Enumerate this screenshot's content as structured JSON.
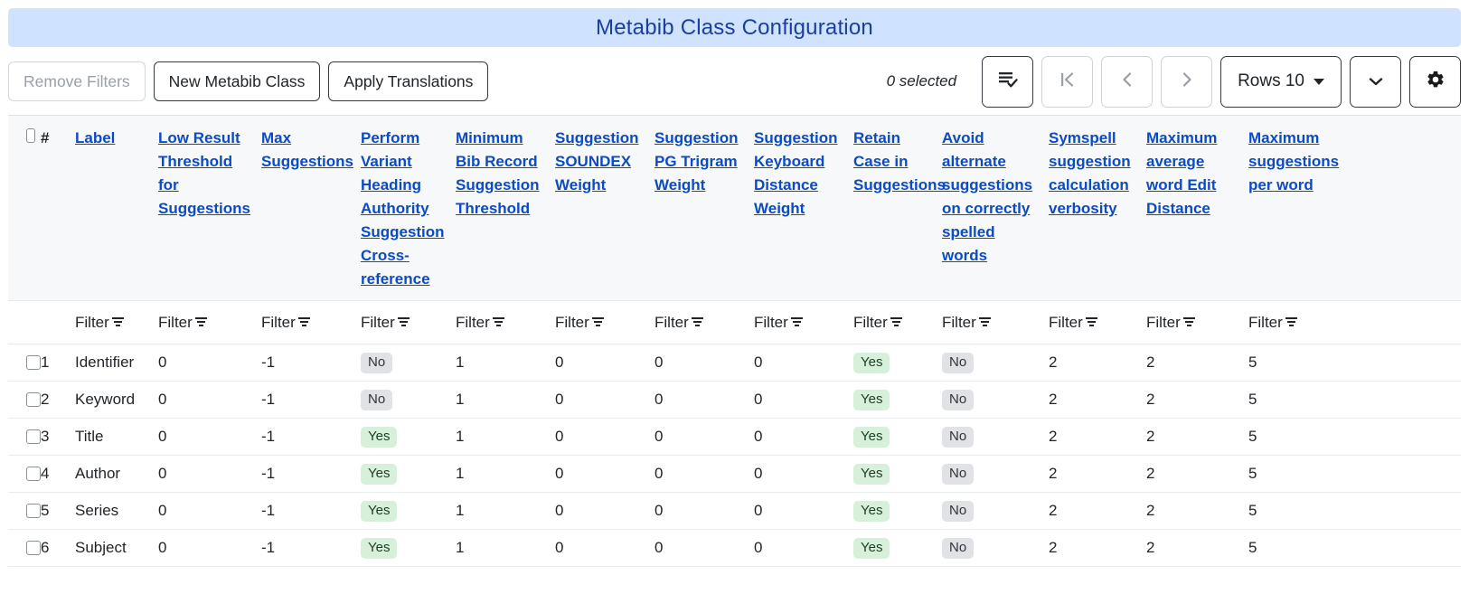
{
  "window": {
    "title": "Metabib Class Configuration",
    "title_bg": "#cfe2ff",
    "title_color": "#1a3fa0"
  },
  "toolbar": {
    "remove_filters_label": "Remove Filters",
    "new_metabib_class_label": "New Metabib Class",
    "apply_translations_label": "Apply Translations",
    "selected_count": "0 selected",
    "select_actions_icon": "list-check-icon",
    "first_page_icon": "first-page-icon",
    "prev_page_icon": "chevron-left-icon",
    "next_page_icon": "chevron-right-icon",
    "rows_label": "Rows 10",
    "rows_caret_icon": "caret-down-icon",
    "expand_icon": "chevron-down-icon",
    "settings_icon": "gear-icon"
  },
  "table": {
    "select_all_checkbox": "select-all-checkbox",
    "filter_label": "Filter",
    "filter_icon": "funnel-icon",
    "columns": [
      {
        "key": "num",
        "label": "#",
        "type": "plain"
      },
      {
        "key": "label",
        "label": "Label",
        "type": "link"
      },
      {
        "key": "c0",
        "label": "Low Result Threshold for Suggestions",
        "type": "link"
      },
      {
        "key": "c1",
        "label": "Max Suggestions",
        "type": "link"
      },
      {
        "key": "c2",
        "label": "Perform Variant Heading Authority Suggestion Cross-reference",
        "type": "link"
      },
      {
        "key": "c3",
        "label": "Minimum Bib Record Suggestion Threshold",
        "type": "link"
      },
      {
        "key": "c4",
        "label": "Suggestion SOUNDEX Weight",
        "type": "link"
      },
      {
        "key": "c5",
        "label": "Suggestion PG Trigram Weight",
        "type": "link"
      },
      {
        "key": "c6",
        "label": "Suggestion Keyboard Distance Weight",
        "type": "link"
      },
      {
        "key": "c7",
        "label": "Retain Case in Suggestions",
        "type": "link"
      },
      {
        "key": "c8",
        "label": "Avoid alternate suggestions on correctly spelled words",
        "type": "link"
      },
      {
        "key": "c9",
        "label": "Symspell suggestion calculation verbosity",
        "type": "link"
      },
      {
        "key": "c10",
        "label": "Maximum average word Edit Distance",
        "type": "link"
      },
      {
        "key": "c11",
        "label": "Maximum suggestions per word",
        "type": "link"
      }
    ],
    "rows": [
      {
        "num": "1",
        "label": "Identifier",
        "c0": "0",
        "c1": "-1",
        "c2": "No",
        "c3": "1",
        "c4": "0",
        "c5": "0",
        "c6": "0",
        "c7": "Yes",
        "c8": "No",
        "c9": "2",
        "c10": "2",
        "c11": "5"
      },
      {
        "num": "2",
        "label": "Keyword",
        "c0": "0",
        "c1": "-1",
        "c2": "No",
        "c3": "1",
        "c4": "0",
        "c5": "0",
        "c6": "0",
        "c7": "Yes",
        "c8": "No",
        "c9": "2",
        "c10": "2",
        "c11": "5"
      },
      {
        "num": "3",
        "label": "Title",
        "c0": "0",
        "c1": "-1",
        "c2": "Yes",
        "c3": "1",
        "c4": "0",
        "c5": "0",
        "c6": "0",
        "c7": "Yes",
        "c8": "No",
        "c9": "2",
        "c10": "2",
        "c11": "5"
      },
      {
        "num": "4",
        "label": "Author",
        "c0": "0",
        "c1": "-1",
        "c2": "Yes",
        "c3": "1",
        "c4": "0",
        "c5": "0",
        "c6": "0",
        "c7": "Yes",
        "c8": "No",
        "c9": "2",
        "c10": "2",
        "c11": "5"
      },
      {
        "num": "5",
        "label": "Series",
        "c0": "0",
        "c1": "-1",
        "c2": "Yes",
        "c3": "1",
        "c4": "0",
        "c5": "0",
        "c6": "0",
        "c7": "Yes",
        "c8": "No",
        "c9": "2",
        "c10": "2",
        "c11": "5"
      },
      {
        "num": "6",
        "label": "Subject",
        "c0": "0",
        "c1": "-1",
        "c2": "Yes",
        "c3": "1",
        "c4": "0",
        "c5": "0",
        "c6": "0",
        "c7": "Yes",
        "c8": "No",
        "c9": "2",
        "c10": "2",
        "c11": "5"
      }
    ]
  },
  "colors": {
    "link": "#0b4bc4",
    "badge_yes_bg": "#d7f0d9",
    "badge_no_bg": "#e0e2e6",
    "header_bg": "#f7f8f9"
  }
}
